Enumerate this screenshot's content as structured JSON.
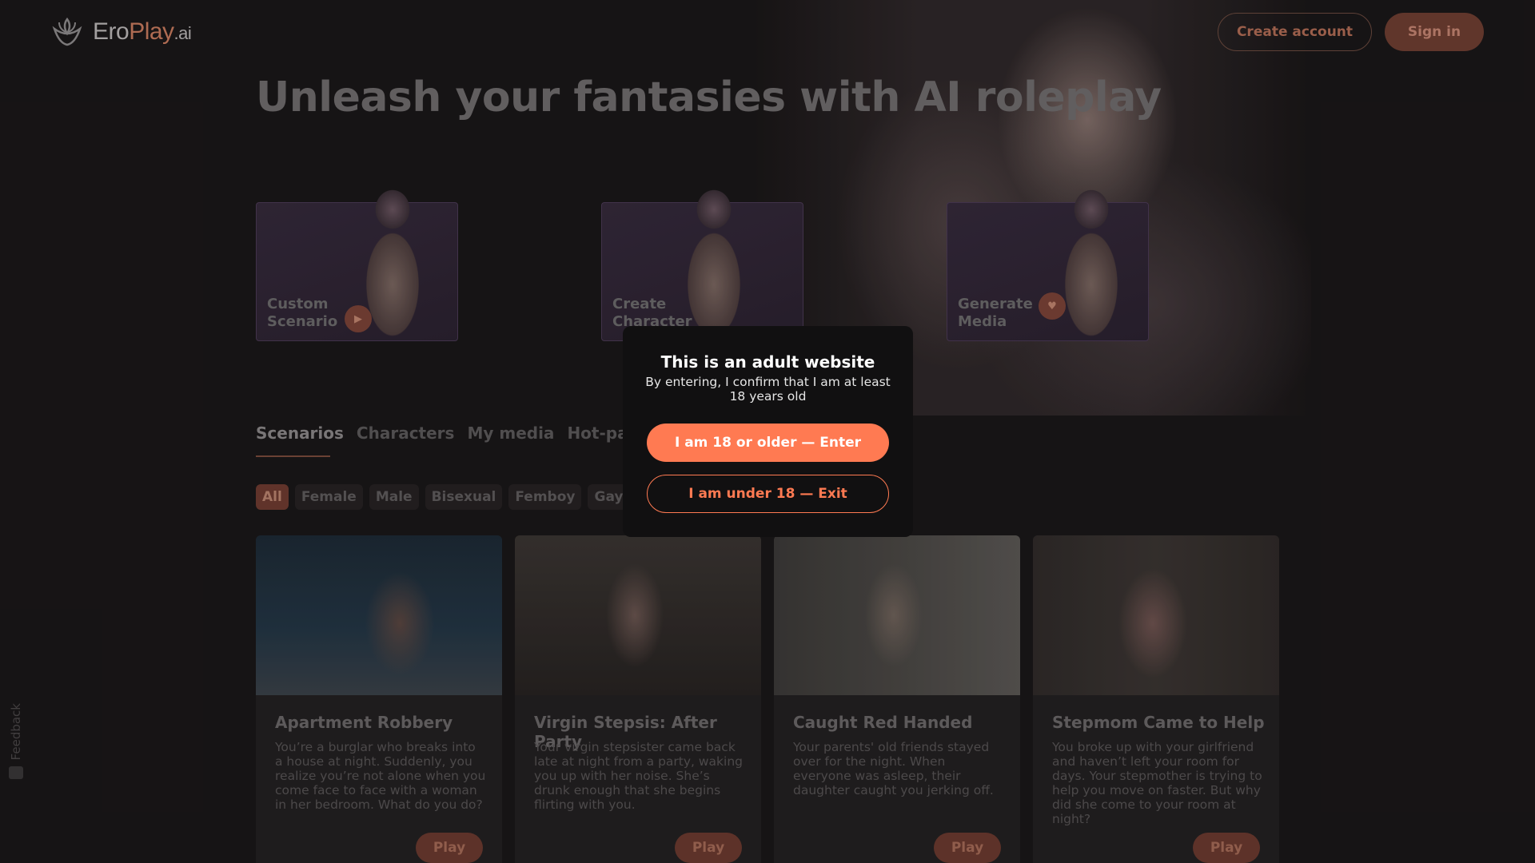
{
  "header": {
    "logo": {
      "part1": "Ero",
      "part2": "Play",
      "part3": ".ai",
      "icon": "mask-leaf-icon"
    },
    "create_account_label": "Create account",
    "sign_in_label": "Sign in"
  },
  "hero": {
    "title": "Unleash your fantasies with AI roleplay"
  },
  "features": [
    {
      "line1": "Custom",
      "line2": "Scenario"
    },
    {
      "line1": "Create",
      "line2": "Character"
    },
    {
      "line1": "Generate",
      "line2": "Media"
    }
  ],
  "tabs": [
    {
      "label": "Scenarios",
      "active": true
    },
    {
      "label": "Characters"
    },
    {
      "label": "My media"
    },
    {
      "label": "Hot-packs"
    }
  ],
  "filters": [
    {
      "label": "All",
      "active": true
    },
    {
      "label": "Female"
    },
    {
      "label": "Male"
    },
    {
      "label": "Bisexual"
    },
    {
      "label": "Femboy"
    },
    {
      "label": "Gay"
    }
  ],
  "cards": [
    {
      "title": "Apartment Robbery",
      "description": "You’re a burglar who breaks into a house at night. Suddenly, you realize you’re not alone when you come face to face with a woman in her bedroom. What do you do?",
      "play_label": "Play"
    },
    {
      "title": "Virgin Stepsis: After Party",
      "description": "Your virgin stepsister came back late at night from a party, waking you up with her noise. She’s drunk enough that she begins flirting with you.",
      "play_label": "Play"
    },
    {
      "title": "Caught Red Handed",
      "description": "Your parents' old friends stayed over for the night. When everyone was asleep, their daughter caught you jerking off.",
      "play_label": "Play"
    },
    {
      "title": "Stepmom Came to Help",
      "description": "You broke up with your girlfriend and haven’t left your room for days. Your stepmother is trying to help you move on faster. But why did she come to your room at night?",
      "play_label": "Play"
    }
  ],
  "feedback": {
    "label": "Feedback"
  },
  "modal": {
    "title": "This is an adult website",
    "subtitle": "By entering, I confirm that I am at least 18 years old",
    "enter_label": "I am 18 or older — Enter",
    "exit_label": "I am under 18 — Exit"
  },
  "colors": {
    "accent": "#ff7a52",
    "background": "#1a1718",
    "modal_bg": "#111011"
  }
}
